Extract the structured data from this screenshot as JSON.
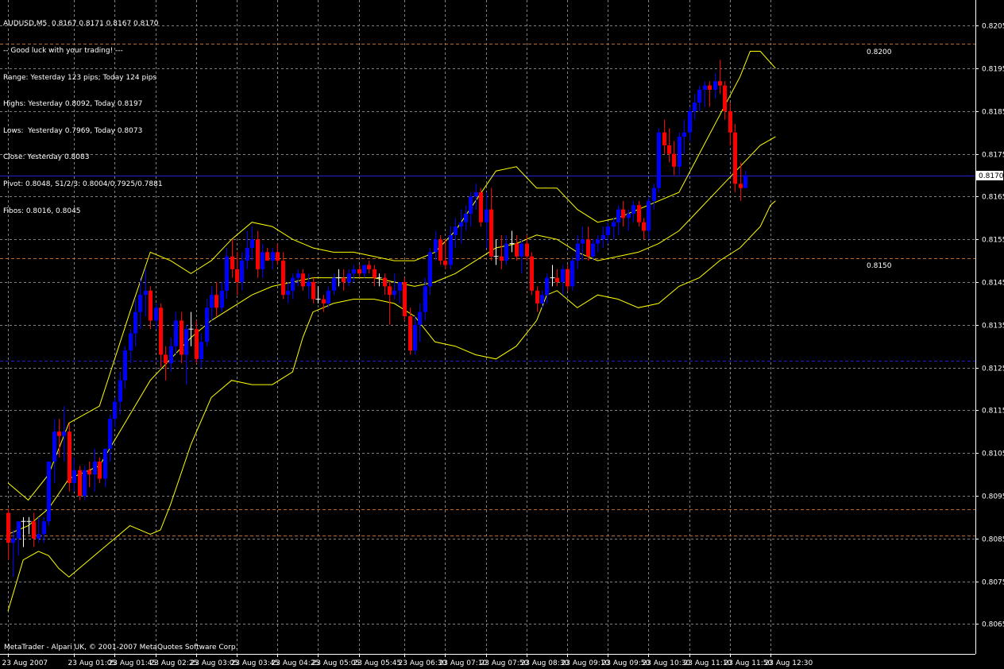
{
  "header": {
    "symbol_line": "AUDUSD,M5  0.8167 0.8171 0.8167 0.8170",
    "lines": [
      "-- Good luck with your trading! ---",
      "Range: Yesterday 123 pips; Today 124 pips",
      "Highs: Yesterday 0.8092, Today 0.8197",
      "Lows:  Yesterday 0.7969, Today 0.8073",
      "Close: Yesterday 0.8083",
      "Pivot: 0.8048, S1/2/3: 0.8004/0.7925/0.7881",
      "Fibos: 0.8016, 0.8045"
    ]
  },
  "footer": {
    "copyright": "MetaTrader - Alpari UK, © 2001-2007 MetaQuotes Software Corp."
  },
  "colors": {
    "background": "#000000",
    "grid": "#7f7f7f",
    "bull": "#0000ff",
    "bear": "#ff0000",
    "doji": "#ffffff",
    "bands": "#ffff00",
    "hline_blue": "#1f1fc8",
    "hline_orange": "#b96a2a"
  },
  "chart_data": {
    "type": "candlestick",
    "symbol": "AUDUSD",
    "timeframe": "M5",
    "current_price": "0.8170",
    "ylim": [
      0.8058,
      0.8211
    ],
    "y_ticks": [
      "0.8065",
      "0.8075",
      "0.8085",
      "0.8095",
      "0.8105",
      "0.8115",
      "0.8125",
      "0.8135",
      "0.8145",
      "0.8155",
      "0.8165",
      "0.8175",
      "0.8185",
      "0.8195",
      "0.8205"
    ],
    "x_ticks": [
      "23 Aug 2007",
      "23 Aug 01:05",
      "23 Aug 01:45",
      "23 Aug 02:25",
      "23 Aug 03:05",
      "23 Aug 03:45",
      "23 Aug 04:25",
      "23 Aug 05:05",
      "23 Aug 05:45",
      "23 Aug 06:30",
      "23 Aug 07:10",
      "23 Aug 07:50",
      "23 Aug 08:30",
      "23 Aug 09:10",
      "23 Aug 09:50",
      "23 Aug 10:30",
      "23 Aug 11:10",
      "23 Aug 11:50",
      "23 Aug 12:30"
    ],
    "x_tick_bar_index": [
      0,
      13,
      21,
      29,
      37,
      45,
      53,
      61,
      69,
      78,
      86,
      94,
      102,
      110,
      118,
      126,
      134,
      142,
      150
    ],
    "annotations": [
      {
        "text": "0.8200",
        "price": 0.82
      },
      {
        "text": "0.8150",
        "price": 0.815
      }
    ],
    "horizontal_levels": [
      {
        "price": 0.817,
        "style": "solid",
        "color": "hline_blue"
      },
      {
        "price": 0.81266,
        "style": "dashed",
        "color": "hline_blue"
      },
      {
        "price": 0.80918,
        "style": "dashed",
        "color": "hline_orange"
      },
      {
        "price": 0.80857,
        "style": "dashed",
        "color": "hline_orange"
      },
      {
        "price": 0.81506,
        "style": "dashed",
        "color": "hline_orange"
      },
      {
        "price": 0.82007,
        "style": "dashed",
        "color": "hline_orange"
      }
    ],
    "ohlc": [
      [
        0.8091,
        0.8092,
        0.808,
        0.8084
      ],
      [
        0.8084,
        0.8087,
        0.8076,
        0.8085
      ],
      [
        0.8085,
        0.8089,
        0.8081,
        0.8089
      ],
      [
        0.8089,
        0.809,
        0.8083,
        0.8089
      ],
      [
        0.8089,
        0.809,
        0.8086,
        0.8089
      ],
      [
        0.8089,
        0.8091,
        0.8083,
        0.8085
      ],
      [
        0.8085,
        0.809,
        0.8084,
        0.8086
      ],
      [
        0.8086,
        0.809,
        0.8084,
        0.8089
      ],
      [
        0.8089,
        0.8103,
        0.8088,
        0.8103
      ],
      [
        0.8103,
        0.8113,
        0.8098,
        0.811
      ],
      [
        0.811,
        0.8113,
        0.8104,
        0.8109
      ],
      [
        0.8109,
        0.8116,
        0.8103,
        0.811
      ],
      [
        0.811,
        0.8112,
        0.8096,
        0.8098
      ],
      [
        0.8098,
        0.8104,
        0.8096,
        0.8101
      ],
      [
        0.8101,
        0.8102,
        0.8094,
        0.8095
      ],
      [
        0.8095,
        0.8102,
        0.8094,
        0.8101
      ],
      [
        0.8101,
        0.8103,
        0.8097,
        0.81
      ],
      [
        0.81,
        0.8106,
        0.8096,
        0.8103
      ],
      [
        0.8103,
        0.8104,
        0.8098,
        0.8099
      ],
      [
        0.8099,
        0.8106,
        0.8097,
        0.8106
      ],
      [
        0.8106,
        0.8114,
        0.8103,
        0.8113
      ],
      [
        0.8113,
        0.8118,
        0.8111,
        0.8117
      ],
      [
        0.8117,
        0.8124,
        0.8114,
        0.8122
      ],
      [
        0.8122,
        0.813,
        0.812,
        0.8129
      ],
      [
        0.8129,
        0.8134,
        0.8126,
        0.8133
      ],
      [
        0.8133,
        0.8141,
        0.813,
        0.8138
      ],
      [
        0.8138,
        0.8146,
        0.8134,
        0.8142
      ],
      [
        0.8142,
        0.8148,
        0.8137,
        0.8143
      ],
      [
        0.8143,
        0.8144,
        0.8134,
        0.8136
      ],
      [
        0.8136,
        0.814,
        0.8134,
        0.8139
      ],
      [
        0.8139,
        0.814,
        0.8125,
        0.8128
      ],
      [
        0.8128,
        0.813,
        0.8122,
        0.8126
      ],
      [
        0.8126,
        0.8132,
        0.8124,
        0.813
      ],
      [
        0.813,
        0.8138,
        0.8128,
        0.8136
      ],
      [
        0.8136,
        0.8138,
        0.8126,
        0.8128
      ],
      [
        0.8128,
        0.8135,
        0.8121,
        0.8134
      ],
      [
        0.8134,
        0.8138,
        0.813,
        0.8134
      ],
      [
        0.8134,
        0.8136,
        0.8126,
        0.8127
      ],
      [
        0.8127,
        0.8133,
        0.8125,
        0.8131
      ],
      [
        0.8131,
        0.8141,
        0.813,
        0.8139
      ],
      [
        0.8139,
        0.8144,
        0.8136,
        0.8142
      ],
      [
        0.8142,
        0.8145,
        0.8137,
        0.8139
      ],
      [
        0.8139,
        0.8145,
        0.8138,
        0.8143
      ],
      [
        0.8143,
        0.8153,
        0.8141,
        0.8151
      ],
      [
        0.8151,
        0.8155,
        0.8146,
        0.8148
      ],
      [
        0.8148,
        0.8152,
        0.8142,
        0.8145
      ],
      [
        0.8145,
        0.8152,
        0.8143,
        0.815
      ],
      [
        0.815,
        0.8157,
        0.8148,
        0.8153
      ],
      [
        0.8153,
        0.8158,
        0.815,
        0.8155
      ],
      [
        0.8155,
        0.8157,
        0.8146,
        0.8148
      ],
      [
        0.8148,
        0.8154,
        0.8146,
        0.8152
      ],
      [
        0.8152,
        0.8153,
        0.815,
        0.815
      ],
      [
        0.815,
        0.8153,
        0.8148,
        0.8152
      ],
      [
        0.8152,
        0.8154,
        0.8149,
        0.815
      ],
      [
        0.815,
        0.8152,
        0.8141,
        0.8142
      ],
      [
        0.8142,
        0.8145,
        0.814,
        0.8143
      ],
      [
        0.8143,
        0.8147,
        0.8141,
        0.8146
      ],
      [
        0.8146,
        0.8148,
        0.8144,
        0.8147
      ],
      [
        0.8147,
        0.8148,
        0.8143,
        0.8144
      ],
      [
        0.8144,
        0.8147,
        0.8141,
        0.8145
      ],
      [
        0.8145,
        0.8146,
        0.814,
        0.8141
      ],
      [
        0.8141,
        0.8144,
        0.814,
        0.8141
      ],
      [
        0.8141,
        0.8142,
        0.8138,
        0.814
      ],
      [
        0.814,
        0.8144,
        0.8139,
        0.8143
      ],
      [
        0.8143,
        0.8147,
        0.8142,
        0.8146
      ],
      [
        0.8146,
        0.8148,
        0.8144,
        0.8146
      ],
      [
        0.8146,
        0.8148,
        0.8143,
        0.8145
      ],
      [
        0.8145,
        0.8148,
        0.8144,
        0.8147
      ],
      [
        0.8147,
        0.8149,
        0.8145,
        0.8148
      ],
      [
        0.8148,
        0.8149,
        0.8146,
        0.8147
      ],
      [
        0.8147,
        0.8149,
        0.8146,
        0.8149
      ],
      [
        0.8149,
        0.815,
        0.8147,
        0.8148
      ],
      [
        0.8148,
        0.8149,
        0.8144,
        0.8146
      ],
      [
        0.8146,
        0.8147,
        0.8144,
        0.8146
      ],
      [
        0.8146,
        0.8147,
        0.8142,
        0.8144
      ],
      [
        0.8144,
        0.8145,
        0.8135,
        0.8142
      ],
      [
        0.8142,
        0.8147,
        0.8141,
        0.8143
      ],
      [
        0.8143,
        0.8145,
        0.814,
        0.8145
      ],
      [
        0.8145,
        0.8146,
        0.8136,
        0.8137
      ],
      [
        0.8137,
        0.8139,
        0.8128,
        0.8129
      ],
      [
        0.8129,
        0.8137,
        0.8128,
        0.8135
      ],
      [
        0.8135,
        0.814,
        0.8131,
        0.8138
      ],
      [
        0.8138,
        0.8146,
        0.8136,
        0.8144
      ],
      [
        0.8144,
        0.8153,
        0.8142,
        0.8152
      ],
      [
        0.8152,
        0.8157,
        0.815,
        0.8155
      ],
      [
        0.8155,
        0.8156,
        0.8149,
        0.815
      ],
      [
        0.815,
        0.8155,
        0.8148,
        0.8149
      ],
      [
        0.8149,
        0.8158,
        0.8148,
        0.8156
      ],
      [
        0.8156,
        0.816,
        0.8153,
        0.8158
      ],
      [
        0.8158,
        0.8162,
        0.8154,
        0.8159
      ],
      [
        0.8159,
        0.8163,
        0.8157,
        0.8161
      ],
      [
        0.8161,
        0.8166,
        0.8158,
        0.8165
      ],
      [
        0.8165,
        0.8168,
        0.8162,
        0.8166
      ],
      [
        0.8166,
        0.8167,
        0.8158,
        0.8159
      ],
      [
        0.8159,
        0.8166,
        0.8153,
        0.8162
      ],
      [
        0.8162,
        0.8167,
        0.815,
        0.8151
      ],
      [
        0.8151,
        0.8155,
        0.8149,
        0.8151
      ],
      [
        0.8151,
        0.8156,
        0.8148,
        0.815
      ],
      [
        0.815,
        0.8156,
        0.8149,
        0.8154
      ],
      [
        0.8154,
        0.8157,
        0.8152,
        0.8154
      ],
      [
        0.8154,
        0.8156,
        0.815,
        0.8151
      ],
      [
        0.8151,
        0.8155,
        0.8147,
        0.8154
      ],
      [
        0.8154,
        0.8156,
        0.815,
        0.8151
      ],
      [
        0.8151,
        0.8152,
        0.8142,
        0.8143
      ],
      [
        0.8143,
        0.8144,
        0.8138,
        0.814
      ],
      [
        0.814,
        0.8143,
        0.8139,
        0.8142
      ],
      [
        0.8142,
        0.8147,
        0.814,
        0.8146
      ],
      [
        0.8146,
        0.8149,
        0.8144,
        0.8146
      ],
      [
        0.8146,
        0.8148,
        0.8144,
        0.8145
      ],
      [
        0.8145,
        0.8149,
        0.8142,
        0.8148
      ],
      [
        0.8148,
        0.8149,
        0.8143,
        0.8144
      ],
      [
        0.8144,
        0.8151,
        0.8143,
        0.815
      ],
      [
        0.815,
        0.8156,
        0.8148,
        0.8154
      ],
      [
        0.8154,
        0.8158,
        0.815,
        0.8155
      ],
      [
        0.8155,
        0.8158,
        0.815,
        0.8151
      ],
      [
        0.8151,
        0.8155,
        0.815,
        0.8154
      ],
      [
        0.8154,
        0.8156,
        0.8152,
        0.8155
      ],
      [
        0.8155,
        0.8158,
        0.8153,
        0.8156
      ],
      [
        0.8156,
        0.8159,
        0.8154,
        0.8158
      ],
      [
        0.8158,
        0.816,
        0.8155,
        0.8159
      ],
      [
        0.8159,
        0.8163,
        0.8156,
        0.8162
      ],
      [
        0.8162,
        0.8164,
        0.8158,
        0.816
      ],
      [
        0.816,
        0.8162,
        0.8157,
        0.8161
      ],
      [
        0.8161,
        0.8164,
        0.8159,
        0.8163
      ],
      [
        0.8163,
        0.8164,
        0.8158,
        0.8159
      ],
      [
        0.8159,
        0.816,
        0.8155,
        0.8157
      ],
      [
        0.8157,
        0.8165,
        0.8155,
        0.8164
      ],
      [
        0.8164,
        0.8168,
        0.8162,
        0.8167
      ],
      [
        0.8167,
        0.8181,
        0.8166,
        0.818
      ],
      [
        0.818,
        0.8183,
        0.8175,
        0.8177
      ],
      [
        0.8177,
        0.8181,
        0.8173,
        0.8175
      ],
      [
        0.8175,
        0.8178,
        0.817,
        0.8172
      ],
      [
        0.8172,
        0.818,
        0.817,
        0.8179
      ],
      [
        0.8179,
        0.8183,
        0.8175,
        0.818
      ],
      [
        0.818,
        0.8186,
        0.8178,
        0.8185
      ],
      [
        0.8185,
        0.8189,
        0.8183,
        0.8187
      ],
      [
        0.8187,
        0.8191,
        0.8185,
        0.819
      ],
      [
        0.819,
        0.8192,
        0.8186,
        0.8191
      ],
      [
        0.8191,
        0.8192,
        0.8186,
        0.819
      ],
      [
        0.819,
        0.8194,
        0.8188,
        0.8192
      ],
      [
        0.8192,
        0.8197,
        0.8189,
        0.8191
      ],
      [
        0.8191,
        0.8192,
        0.8183,
        0.8185
      ],
      [
        0.8185,
        0.8187,
        0.8177,
        0.818
      ],
      [
        0.818,
        0.8182,
        0.8166,
        0.8168
      ],
      [
        0.8168,
        0.8173,
        0.8164,
        0.8167
      ],
      [
        0.8167,
        0.8171,
        0.8167,
        0.817
      ]
    ],
    "bands_upper": [
      [
        0,
        0.8098
      ],
      [
        4,
        0.8094
      ],
      [
        8,
        0.81
      ],
      [
        12,
        0.8112
      ],
      [
        18,
        0.8116
      ],
      [
        24,
        0.8138
      ],
      [
        28,
        0.8152
      ],
      [
        32,
        0.815
      ],
      [
        36,
        0.8147
      ],
      [
        40,
        0.815
      ],
      [
        44,
        0.8155
      ],
      [
        48,
        0.8159
      ],
      [
        52,
        0.8158
      ],
      [
        56,
        0.8155
      ],
      [
        60,
        0.8153
      ],
      [
        64,
        0.8152
      ],
      [
        68,
        0.8152
      ],
      [
        72,
        0.8151
      ],
      [
        76,
        0.815
      ],
      [
        80,
        0.815
      ],
      [
        84,
        0.8152
      ],
      [
        88,
        0.8157
      ],
      [
        92,
        0.8164
      ],
      [
        96,
        0.8171
      ],
      [
        100,
        0.8172
      ],
      [
        104,
        0.8167
      ],
      [
        108,
        0.8167
      ],
      [
        112,
        0.8162
      ],
      [
        116,
        0.8159
      ],
      [
        120,
        0.816
      ],
      [
        124,
        0.8162
      ],
      [
        128,
        0.8164
      ],
      [
        132,
        0.8166
      ],
      [
        136,
        0.8175
      ],
      [
        140,
        0.8184
      ],
      [
        144,
        0.8193
      ],
      [
        146,
        0.8199
      ],
      [
        148,
        0.8199
      ],
      [
        151,
        0.8195
      ]
    ],
    "bands_middle": [
      [
        0,
        0.8086
      ],
      [
        4,
        0.8088
      ],
      [
        8,
        0.8092
      ],
      [
        12,
        0.8099
      ],
      [
        18,
        0.8102
      ],
      [
        24,
        0.8114
      ],
      [
        28,
        0.8122
      ],
      [
        32,
        0.8127
      ],
      [
        36,
        0.8132
      ],
      [
        40,
        0.8136
      ],
      [
        44,
        0.8139
      ],
      [
        48,
        0.8142
      ],
      [
        52,
        0.8144
      ],
      [
        56,
        0.8145
      ],
      [
        60,
        0.8146
      ],
      [
        64,
        0.8146
      ],
      [
        68,
        0.8146
      ],
      [
        72,
        0.8146
      ],
      [
        76,
        0.8145
      ],
      [
        80,
        0.8144
      ],
      [
        84,
        0.8145
      ],
      [
        88,
        0.8147
      ],
      [
        92,
        0.815
      ],
      [
        96,
        0.8153
      ],
      [
        100,
        0.8154
      ],
      [
        104,
        0.8156
      ],
      [
        108,
        0.8155
      ],
      [
        112,
        0.8152
      ],
      [
        116,
        0.815
      ],
      [
        120,
        0.8151
      ],
      [
        124,
        0.8152
      ],
      [
        128,
        0.8154
      ],
      [
        132,
        0.8157
      ],
      [
        136,
        0.8162
      ],
      [
        140,
        0.8167
      ],
      [
        144,
        0.8172
      ],
      [
        148,
        0.8177
      ],
      [
        151,
        0.8179
      ]
    ],
    "bands_lower": [
      [
        0,
        0.8068
      ],
      [
        3,
        0.808
      ],
      [
        6,
        0.8082
      ],
      [
        8,
        0.8081
      ],
      [
        10,
        0.8078
      ],
      [
        12,
        0.8076
      ],
      [
        18,
        0.8082
      ],
      [
        24,
        0.8088
      ],
      [
        28,
        0.8086
      ],
      [
        30,
        0.8087
      ],
      [
        32,
        0.8093
      ],
      [
        36,
        0.8107
      ],
      [
        40,
        0.8118
      ],
      [
        44,
        0.8122
      ],
      [
        48,
        0.8121
      ],
      [
        52,
        0.8121
      ],
      [
        56,
        0.8124
      ],
      [
        58,
        0.8132
      ],
      [
        60,
        0.8138
      ],
      [
        64,
        0.814
      ],
      [
        68,
        0.8141
      ],
      [
        72,
        0.8141
      ],
      [
        76,
        0.814
      ],
      [
        80,
        0.8137
      ],
      [
        84,
        0.8131
      ],
      [
        88,
        0.813
      ],
      [
        92,
        0.8128
      ],
      [
        96,
        0.8127
      ],
      [
        100,
        0.813
      ],
      [
        104,
        0.8136
      ],
      [
        106,
        0.8142
      ],
      [
        108,
        0.8143
      ],
      [
        110,
        0.8141
      ],
      [
        112,
        0.8139
      ],
      [
        116,
        0.8142
      ],
      [
        120,
        0.8141
      ],
      [
        124,
        0.8139
      ],
      [
        128,
        0.814
      ],
      [
        132,
        0.8144
      ],
      [
        136,
        0.8146
      ],
      [
        140,
        0.815
      ],
      [
        144,
        0.8153
      ],
      [
        148,
        0.8158
      ],
      [
        150,
        0.8163
      ],
      [
        151,
        0.8164
      ]
    ]
  }
}
